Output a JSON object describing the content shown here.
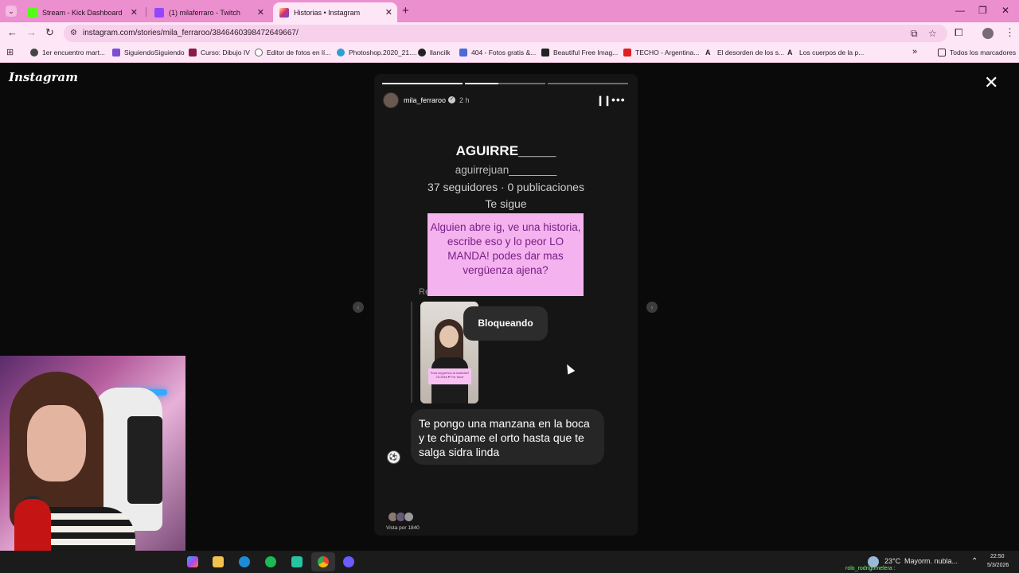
{
  "browser": {
    "tabs": [
      {
        "title": "Stream - Kick Dashboard",
        "favicon_color": "#53fc18",
        "active": false
      },
      {
        "title": "(1) milaferraro - Twitch",
        "favicon_color": "#9146ff",
        "active": false
      },
      {
        "title": "Historias • Instagram",
        "favicon_color": "#d62976",
        "active": true
      }
    ],
    "url": "instagram.com/stories/mila_ferraroo/3846460398472649667/",
    "bookmarks": [
      "1er encuentro mart...",
      "SiguiendoSiguiendo",
      "Curso: Dibujo IV",
      "Editor de fotos en lí...",
      "Photoshop.2020_21....",
      "llancilk",
      "404 - Fotos gratis &...",
      "Beautiful Free Imag...",
      "TECHO - Argentina...",
      "El desorden de los s...",
      "Los cuerpos de la p...",
      "Todos los marcadores"
    ],
    "accent": "#ec8fcf"
  },
  "instagram": {
    "logo": "Instagram",
    "story": {
      "username": "mila_ferraroo",
      "time": "2 h",
      "progress_segments": [
        1.0,
        0.42,
        0.0,
        0.0
      ],
      "profile": {
        "name": "AGUIRRE_____",
        "handle": "aguirrejuan________",
        "stats": "37 seguidores · 0 publicaciones",
        "follows": "Te sigue"
      },
      "overlay_text": "Alguien abre ig, ve una historia, escribe eso y lo peor LO MANDA! podes dar mas vergüenza ajena?",
      "reply_label": "Re",
      "thumb_sticker_text": "Para seguirnos al instante!! 25-30ks ♥ Por favor",
      "tooltip": "Bloqueando",
      "message": "Te pongo una manzana en la boca y te chúpame el orto hasta que te salga sidra linda",
      "viewed_by": "Vista por 1840"
    }
  },
  "taskbar": {
    "weather": "23°C",
    "weather_desc": "Mayorm. nubla...",
    "time": "22:50",
    "date": "5/3/2026",
    "tray_user": "rolo_rodrigomelera :"
  }
}
